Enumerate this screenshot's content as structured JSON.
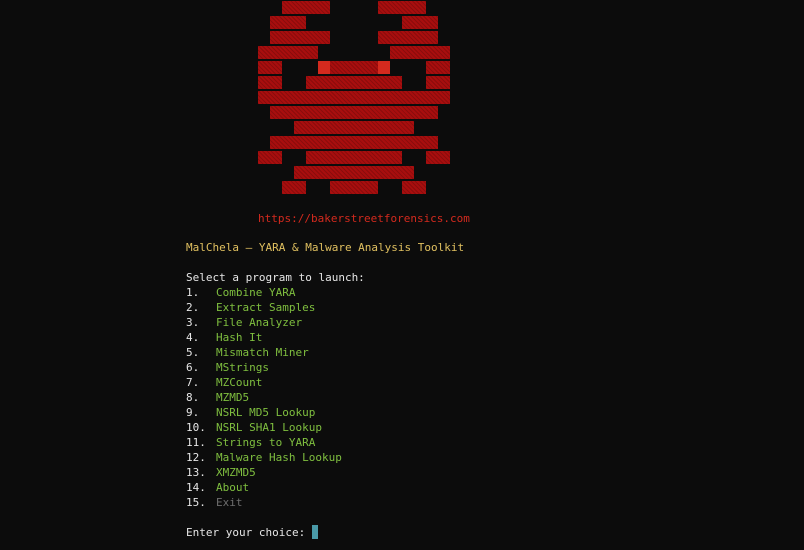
{
  "colors": {
    "background": "#0c0c0c",
    "logo": "#a80e0e",
    "eyes": "#d42a1e",
    "url": "#d42a1e",
    "title": "#e0c060",
    "text": "#e6e6e6",
    "menu_item": "#7fbf3f",
    "menu_disabled": "#6e6e6e",
    "cursor": "#4a9aa8"
  },
  "logo_icon": "crab-logo-icon",
  "url": "https://bakerstreetforensics.com",
  "title": "MalChela – YARA & Malware Analysis Toolkit",
  "prompt_heading": "Select a program to launch:",
  "menu": [
    {
      "num": "1.",
      "label": "Combine YARA"
    },
    {
      "num": "2.",
      "label": "Extract Samples"
    },
    {
      "num": "3.",
      "label": "File Analyzer"
    },
    {
      "num": "4.",
      "label": "Hash It"
    },
    {
      "num": "5.",
      "label": "Mismatch Miner"
    },
    {
      "num": "6.",
      "label": "MStrings"
    },
    {
      "num": "7.",
      "label": "MZCount"
    },
    {
      "num": "8.",
      "label": "MZMD5"
    },
    {
      "num": "9.",
      "label": "NSRL MD5 Lookup"
    },
    {
      "num": "10.",
      "label": "NSRL SHA1 Lookup"
    },
    {
      "num": "11.",
      "label": "Strings to YARA"
    },
    {
      "num": "12.",
      "label": "Malware Hash Lookup"
    },
    {
      "num": "13.",
      "label": "XMZMD5"
    },
    {
      "num": "14.",
      "label": "About"
    },
    {
      "num": "15.",
      "label": "Exit"
    }
  ],
  "input_prompt": "Enter your choice: "
}
